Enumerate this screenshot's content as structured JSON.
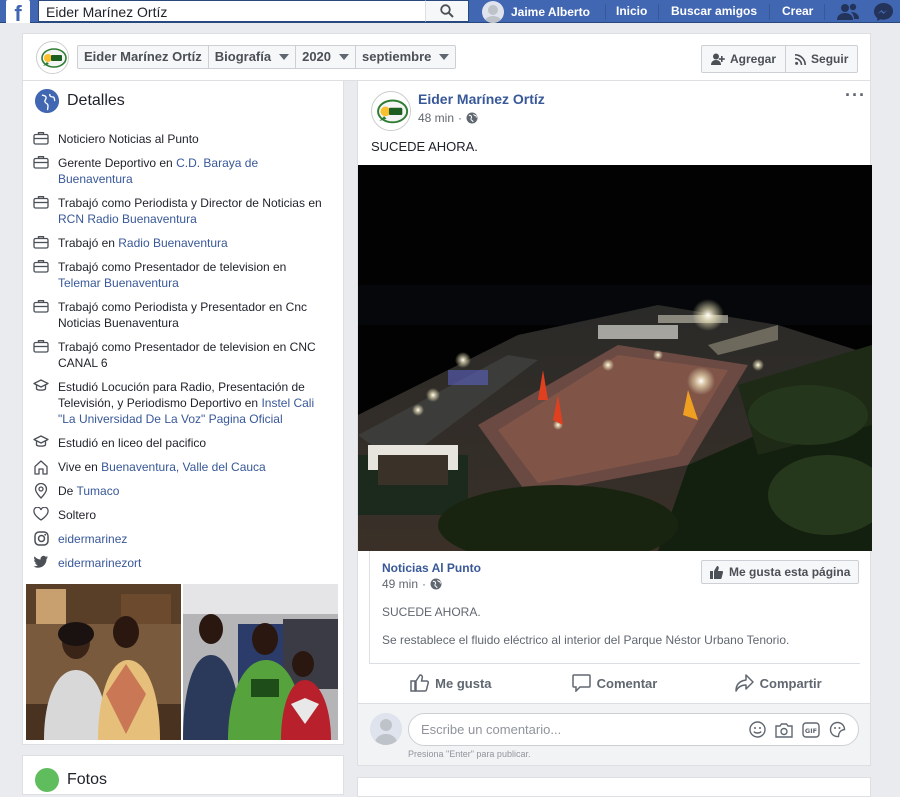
{
  "topbar": {
    "search_value": "Eider Marínez Ortíz",
    "user_name": "Jaime Alberto",
    "nav": [
      "Inicio",
      "Buscar amigos",
      "Crear"
    ]
  },
  "page_header": {
    "crumbs": [
      "Eider Marínez Ortíz",
      "Biografía",
      "2020",
      "septiembre"
    ],
    "add_button": "Agregar",
    "follow_button": "Seguir"
  },
  "details": {
    "title": "Detalles",
    "items": [
      {
        "icon": "briefcase-icon",
        "text": "Noticiero Noticias al Punto",
        "link": "",
        "text2": ""
      },
      {
        "icon": "briefcase-icon",
        "text": "Gerente Deportivo en ",
        "link": "C.D. Baraya de Buenaventura",
        "text2": ""
      },
      {
        "icon": "briefcase-icon",
        "text": "Trabajó como Periodista y Director de Noticias en ",
        "link": "RCN Radio Buenaventura",
        "text2": ""
      },
      {
        "icon": "briefcase-icon",
        "text": "Trabajó en ",
        "link": "Radio Buenaventura",
        "text2": ""
      },
      {
        "icon": "briefcase-icon",
        "text": "Trabajó como Presentador de television en ",
        "link": "Telemar Buenaventura",
        "text2": ""
      },
      {
        "icon": "briefcase-icon",
        "text": "Trabajó como Periodista y Presentador en Cnc Noticias Buenaventura",
        "link": "",
        "text2": ""
      },
      {
        "icon": "briefcase-icon",
        "text": "Trabajó como Presentador de television en CNC CANAL 6",
        "link": "",
        "text2": ""
      },
      {
        "icon": "graduation-cap-icon",
        "text": "Estudió Locución para Radio, Presentación de Televisión, y Periodismo Deportivo en ",
        "link": "Instel Cali \"La Universidad De La Voz\" Pagina Oficial",
        "text2": ""
      },
      {
        "icon": "graduation-cap-icon",
        "text": "Estudió en liceo del pacifico",
        "link": "",
        "text2": ""
      },
      {
        "icon": "home-icon",
        "text": "Vive en ",
        "link": "Buenaventura, Valle del Cauca",
        "text2": ""
      },
      {
        "icon": "location-pin-icon",
        "text": "De ",
        "link": "Tumaco",
        "text2": ""
      },
      {
        "icon": "heart-icon",
        "text": "Soltero",
        "link": "",
        "text2": ""
      },
      {
        "icon": "instagram-icon",
        "text": "",
        "link": "eidermarinez",
        "text2": ""
      },
      {
        "icon": "twitter-icon",
        "text": "",
        "link": "eidermarinezort",
        "text2": ""
      }
    ]
  },
  "photos_section": {
    "title": "Fotos"
  },
  "post": {
    "author": "Eider Marínez Ortíz",
    "time": "48 min",
    "privacy_icon": "globe-icon",
    "text": "SUCEDE AHORA.",
    "shared": {
      "page": "Noticias Al Punto",
      "time": "49 min",
      "like_page": "Me gusta esta página",
      "line1": "SUCEDE AHORA.",
      "line2": "Se restablece el fluido eléctrico al interior del Parque Néstor Urbano Tenorio."
    },
    "actions": {
      "like": "Me gusta",
      "comment": "Comentar",
      "share": "Compartir"
    },
    "comment_placeholder": "Escribe un comentario...",
    "comment_hint": "Presiona \"Enter\" para publicar."
  },
  "colors": {
    "brand": "#4267b2",
    "link": "#385898",
    "bg": "#e9ebee"
  }
}
